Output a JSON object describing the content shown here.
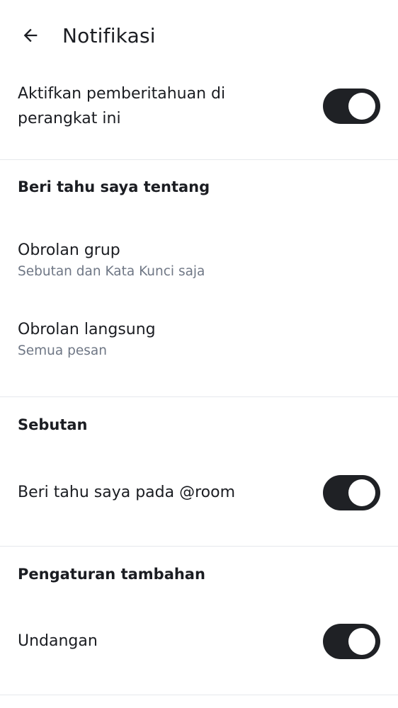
{
  "header": {
    "title": "Notifikasi",
    "back_icon": "arrow-left-icon"
  },
  "enable_notifications": {
    "label_line1": "Aktifkan pemberitahuan di",
    "label_line2": "perangkat ini",
    "enabled": true
  },
  "notify_me_about": {
    "header": "Beri tahu saya tentang",
    "items": [
      {
        "title": "Obrolan grup",
        "subtitle": "Sebutan dan Kata Kunci saja"
      },
      {
        "title": "Obrolan langsung",
        "subtitle": "Semua pesan"
      }
    ]
  },
  "mentions": {
    "header": "Sebutan",
    "room_label": "Beri tahu saya pada @room",
    "room_enabled": true
  },
  "additional_settings": {
    "header": "Pengaturan tambahan",
    "invites_label": "Undangan",
    "invites_enabled": true
  },
  "colors": {
    "toggle_on": "#1f2125",
    "secondary_text": "#6f7785",
    "divider": "#e6e8ec"
  }
}
